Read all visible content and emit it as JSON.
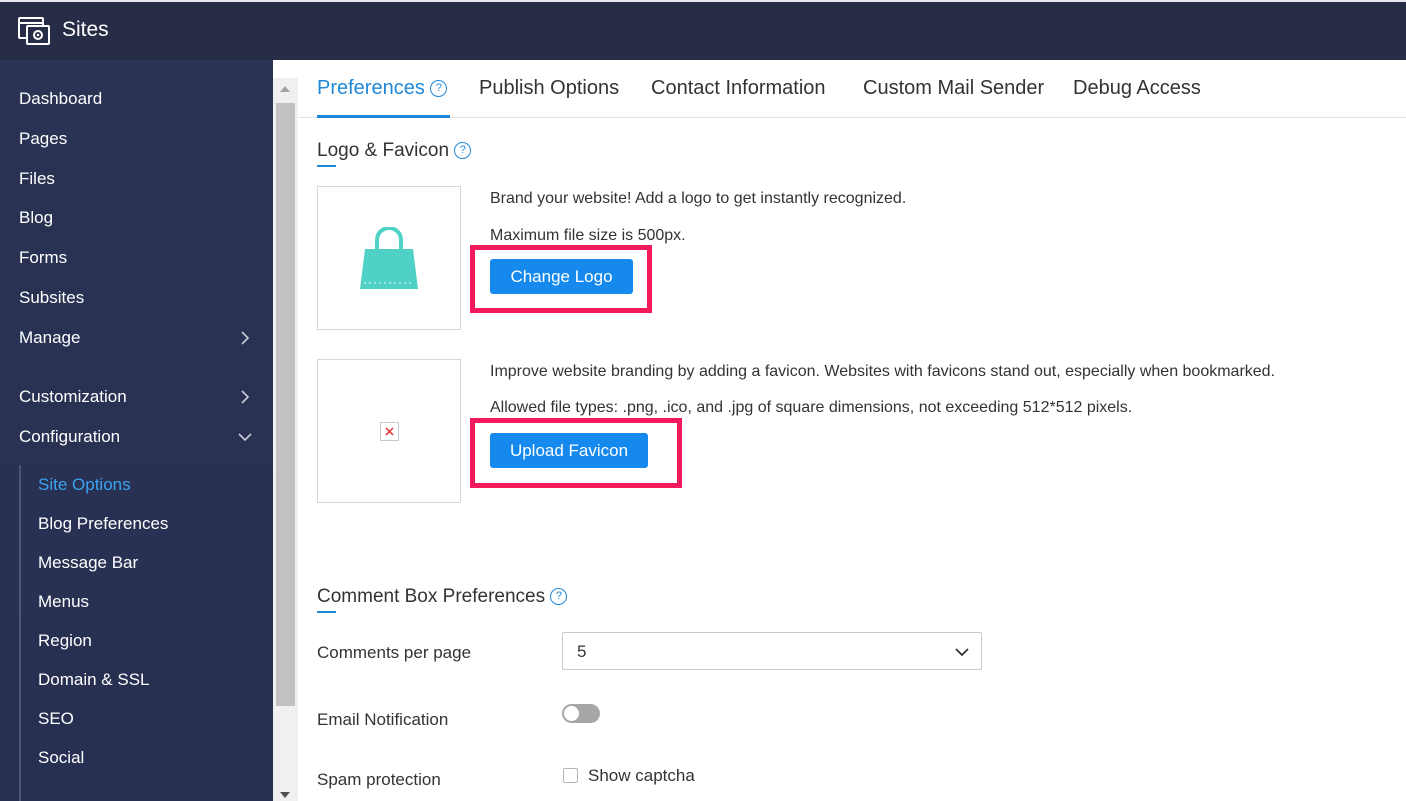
{
  "app": {
    "title": "Sites",
    "logo_icon": "sites-logo-icon"
  },
  "sidebar": {
    "items": [
      {
        "label": "Dashboard"
      },
      {
        "label": "Pages"
      },
      {
        "label": "Files"
      },
      {
        "label": "Blog"
      },
      {
        "label": "Forms"
      },
      {
        "label": "Subsites"
      },
      {
        "label": "Manage",
        "icon": "chevron-right-icon"
      },
      {
        "label": "Customization",
        "icon": "chevron-right-icon"
      },
      {
        "label": "Configuration",
        "icon": "chevron-down-icon"
      }
    ],
    "sub_items": [
      {
        "label": "Site Options",
        "active": true
      },
      {
        "label": "Blog Preferences"
      },
      {
        "label": "Message Bar"
      },
      {
        "label": "Menus"
      },
      {
        "label": "Region"
      },
      {
        "label": "Domain & SSL"
      },
      {
        "label": "SEO"
      },
      {
        "label": "Social"
      }
    ]
  },
  "tabs": [
    {
      "label": "Preferences",
      "active": true
    },
    {
      "label": "Publish Options"
    },
    {
      "label": "Contact Information"
    },
    {
      "label": "Custom Mail Sender"
    },
    {
      "label": "Debug Access"
    }
  ],
  "logo_section": {
    "title": "Logo & Favicon",
    "logo_text": "Brand your website! Add a logo to get instantly recognized.",
    "logo_size_text": "Maximum file size is 500px.",
    "change_logo_label": "Change Logo",
    "favicon_text": "Improve website branding by adding a favicon. Websites with favicons stand out, especially when bookmarked.",
    "favicon_types_text": "Allowed file types: .png, .ico, and .jpg of square dimensions, not exceeding 512*512 pixels.",
    "upload_favicon_label": "Upload Favicon"
  },
  "comment_section": {
    "title": "Comment Box Preferences",
    "comments_per_page_label": "Comments per page",
    "comments_per_page_value": "5",
    "email_notification_label": "Email Notification",
    "email_notification_on": false,
    "spam_protection_label": "Spam protection",
    "show_captcha_label": "Show captcha",
    "show_captcha_checked": false
  },
  "colors": {
    "accent": "#1589ee",
    "sidebar": "#283050",
    "topbar": "#282d47",
    "highlight": "#f2195c",
    "logo_teal": "#4fd1c5"
  }
}
